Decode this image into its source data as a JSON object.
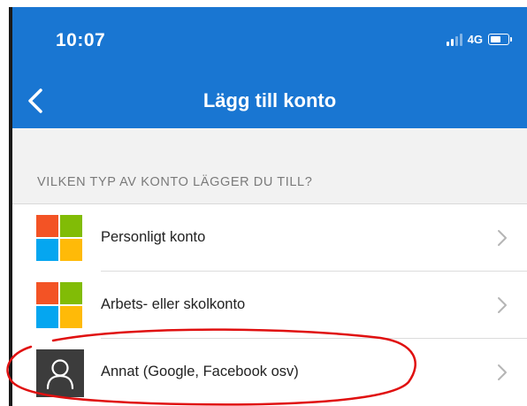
{
  "status_bar": {
    "time": "10:07",
    "network": "4G",
    "icons": [
      "signal-icon",
      "battery-icon"
    ]
  },
  "nav": {
    "title": "Lägg till konto",
    "back_icon": "chevron-left-icon"
  },
  "section": {
    "header": "VILKEN TYP AV KONTO LÄGGER DU TILL?"
  },
  "account_types": [
    {
      "label": "Personligt konto",
      "icon": "microsoft-logo-icon"
    },
    {
      "label": "Arbets- eller skolkonto",
      "icon": "microsoft-logo-icon"
    },
    {
      "label": "Annat (Google, Facebook osv)",
      "icon": "person-icon"
    }
  ],
  "colors": {
    "header_bg": "#1976d2",
    "ms_red": "#f35325",
    "ms_green": "#81bc06",
    "ms_blue": "#05a6f0",
    "ms_yellow": "#ffba08",
    "annotation_red": "#e01010"
  },
  "annotation": {
    "type": "hand-drawn circle",
    "target": "account_types.2"
  }
}
